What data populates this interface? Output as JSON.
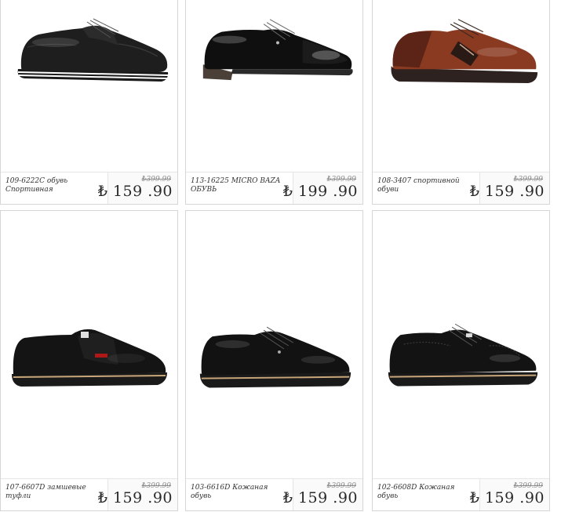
{
  "products": [
    {
      "name": "109-6222C обувь Спортивная",
      "old_price": "₺399.99",
      "price": "₺ 159 .90",
      "image_icon": "black-leather-sneaker-shoe-icon"
    },
    {
      "name": "113-16225 MICRO BAZA ОБУВЬ",
      "old_price": "₺399.99",
      "price": "₺ 199 .90",
      "image_icon": "black-patent-derby-shoe-icon"
    },
    {
      "name": "108-3407 спортивной обуви",
      "old_price": "₺399.99",
      "price": "₺ 159 .90",
      "image_icon": "brown-leather-sneaker-shoe-icon"
    },
    {
      "name": "107-6607D замшевые туфли",
      "old_price": "₺399.99",
      "price": "₺ 159 .90",
      "image_icon": "black-suede-loafer-shoe-icon"
    },
    {
      "name": "103-6616D Кожаная обувь",
      "old_price": "₺399.99",
      "price": "₺ 159 .90",
      "image_icon": "black-leather-derby-shoe-icon"
    },
    {
      "name": "102-6608D Кожаная обувь",
      "old_price": "₺399.99",
      "price": "₺ 159 .90",
      "image_icon": "black-brogue-wingtip-shoe-icon"
    }
  ]
}
